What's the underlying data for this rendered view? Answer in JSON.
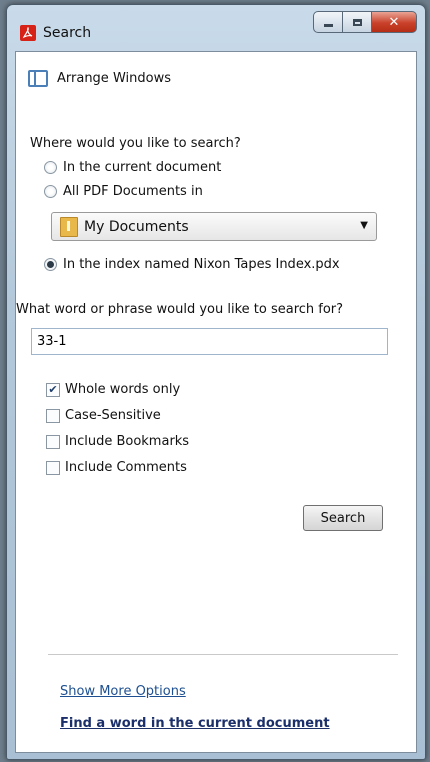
{
  "window": {
    "title": "Search",
    "app_icon": "acrobat-icon",
    "caption_buttons": [
      "minimize-icon",
      "maximize-icon",
      "close-icon"
    ]
  },
  "arrange": {
    "label": "Arrange Windows",
    "icon": "arrange-windows-icon"
  },
  "where": {
    "heading": "Where would you like to search?",
    "options": [
      {
        "label": "In the current document",
        "checked": false
      },
      {
        "label": "All PDF Documents in",
        "checked": false
      },
      {
        "label": "In the index named Nixon Tapes Index.pdx",
        "checked": true
      }
    ],
    "folder": {
      "selected": "My Documents",
      "icon": "folder-icon"
    }
  },
  "query": {
    "heading": "What word or phrase would you like to search for?",
    "value": "33-1"
  },
  "options": [
    {
      "label": "Whole words only",
      "checked": true
    },
    {
      "label": "Case-Sensitive",
      "checked": false
    },
    {
      "label": "Include Bookmarks",
      "checked": false
    },
    {
      "label": "Include Comments",
      "checked": false
    }
  ],
  "search_button": "Search",
  "links": {
    "more_options": "Show More Options",
    "find_word": "Find a word in the current document"
  },
  "colors": {
    "link": "#1d4f91",
    "close_button": "#c9412a",
    "brand": "#d72218"
  }
}
